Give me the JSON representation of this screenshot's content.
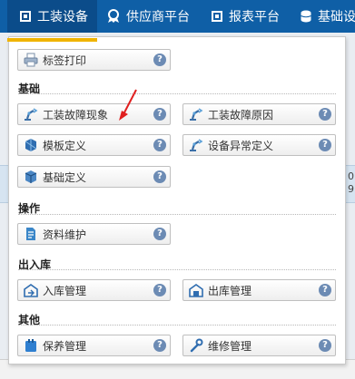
{
  "nav": {
    "items": [
      {
        "label": "工装设备",
        "icon": "square-app-icon"
      },
      {
        "label": "供应商平台",
        "icon": "ribbon-icon"
      },
      {
        "label": "报表平台",
        "icon": "square-app-icon"
      },
      {
        "label": "基础设",
        "icon": "database-icon"
      }
    ]
  },
  "menu": {
    "top_item": {
      "label": "标签打印",
      "icon": "printer-icon"
    },
    "sections": [
      {
        "title": "基础",
        "items": [
          {
            "label": "工装故障现象",
            "icon": "robot-arm-icon"
          },
          {
            "label": "工装故障原因",
            "icon": "robot-arm-icon"
          },
          {
            "label": "模板定义",
            "icon": "template-icon"
          },
          {
            "label": "设备异常定义",
            "icon": "robot-arm-icon"
          },
          {
            "label": "基础定义",
            "icon": "cube-icon"
          }
        ]
      },
      {
        "title": "操作",
        "items": [
          {
            "label": "资料维护",
            "icon": "document-icon"
          }
        ]
      },
      {
        "title": "出入库",
        "items": [
          {
            "label": "入库管理",
            "icon": "warehouse-in-icon"
          },
          {
            "label": "出库管理",
            "icon": "warehouse-out-icon"
          }
        ]
      },
      {
        "title": "其他",
        "items": [
          {
            "label": "保养管理",
            "icon": "maintenance-icon"
          },
          {
            "label": "维修管理",
            "icon": "wrench-icon"
          }
        ]
      }
    ],
    "help_glyph": "?"
  },
  "background": {
    "edge_text": "0\n9"
  },
  "colors": {
    "nav_bg": "#0f5fa6",
    "nav_active_bg": "#0b4c8a",
    "active_underline": "#f0b400",
    "help_icon": "#6c8bb4",
    "annotation_arrow": "#e02020"
  }
}
